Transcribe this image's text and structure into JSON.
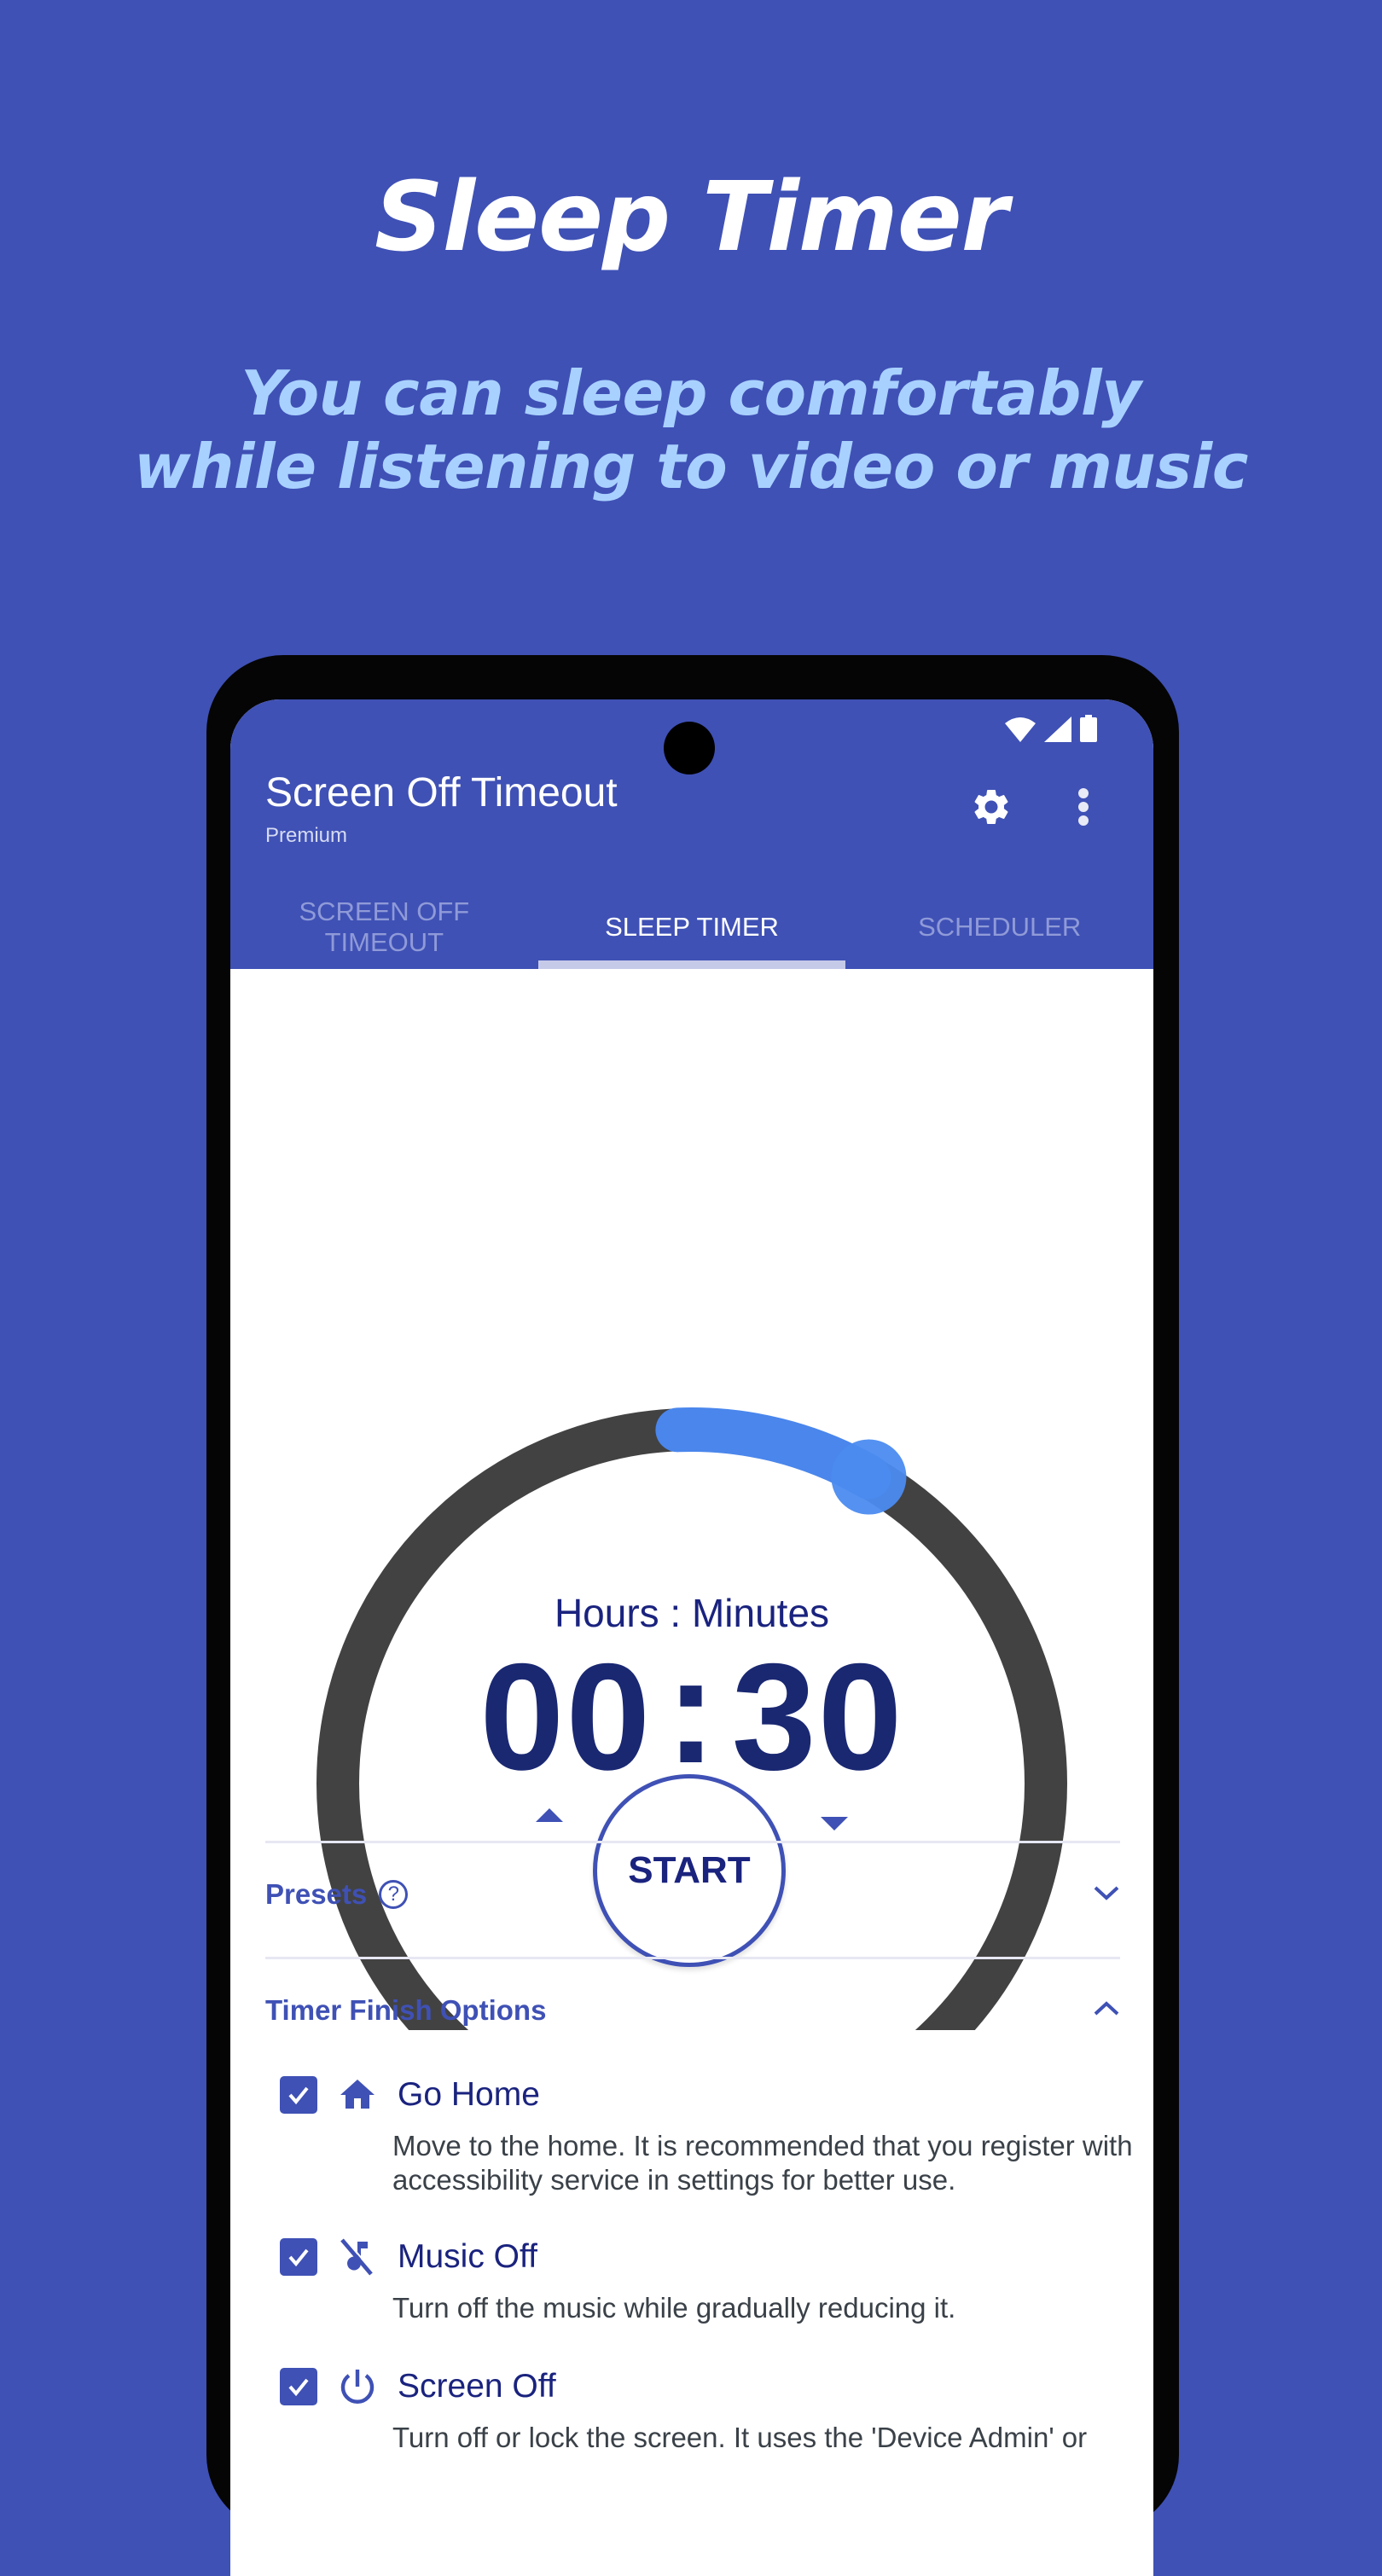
{
  "promo": {
    "title": "Sleep Timer",
    "subtitle_line1": "You can sleep comfortably",
    "subtitle_line2": "while listening to video or music"
  },
  "status_bar": {
    "icons": [
      "wifi-icon",
      "signal-icon",
      "battery-icon"
    ]
  },
  "app_bar": {
    "title": "Screen Off Timeout",
    "subtitle": "Premium",
    "actions": [
      "settings-icon",
      "more-vert-icon"
    ]
  },
  "tabs": [
    {
      "label": "Screen Off\nTimeout",
      "active": false
    },
    {
      "label": "Sleep Timer",
      "active": true
    },
    {
      "label": "Scheduler",
      "active": false
    }
  ],
  "timer": {
    "unit_label": "Hours : Minutes",
    "hours": "00",
    "minutes": "30",
    "separator": ":",
    "display": "00:30",
    "progress_fraction": 0.0833,
    "start_label": "START",
    "increase_icon": "triangle-up-icon",
    "decrease_icon": "triangle-down-icon"
  },
  "colors": {
    "primary": "#3f51b5",
    "primary_dark_text": "#1a237e",
    "progress": "#4a86ec",
    "ring_track": "#424242",
    "subtitle_accent": "#a9d1ff"
  },
  "sections": {
    "presets": {
      "label": "Presets",
      "expanded": false
    },
    "finish_options": {
      "label": "Timer Finish Options",
      "expanded": true
    }
  },
  "finish_options": [
    {
      "title": "Go Home",
      "icon": "home-icon",
      "checked": true,
      "description": "Move to the home. It is recommended that you register with accessibility service in settings for better use."
    },
    {
      "title": "Music Off",
      "icon": "music-off-icon",
      "checked": true,
      "description": "Turn off the music while gradually reducing it."
    },
    {
      "title": "Screen Off",
      "icon": "power-icon",
      "checked": true,
      "description": "Turn off or lock the screen. It uses the 'Device Admin' or"
    }
  ]
}
